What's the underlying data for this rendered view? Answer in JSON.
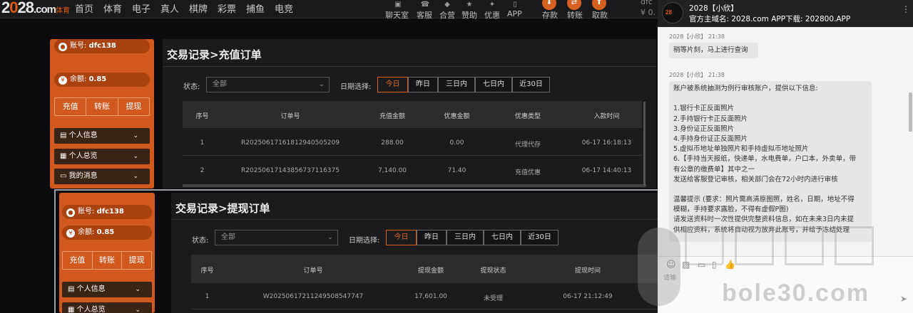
{
  "logo": {
    "text_a": "2",
    "text_b": "0",
    "text_c": "28",
    "text_d": ".com",
    "sub": "体育"
  },
  "nav": [
    "首页",
    "体育",
    "电子",
    "真人",
    "棋牌",
    "彩票",
    "捕鱼",
    "电竞"
  ],
  "right_nav": [
    "聊天室",
    "客服",
    "合营",
    "赞助",
    "优惠",
    "APP"
  ],
  "right_circles": [
    "存款",
    "转账",
    "取款"
  ],
  "user_mini": {
    "name": "dfc",
    "amount": "¥ 0."
  },
  "sidebar": {
    "account_label": "账号:",
    "account": "dfc138",
    "balance_label": "余额:",
    "balance": "0.85",
    "buttons": [
      "充值",
      "转账",
      "提现"
    ],
    "menu": [
      "个人信息",
      "个人总览",
      "我的消息"
    ]
  },
  "deposit_panel": {
    "title": "交易记录>充值订单",
    "status_label": "状态:",
    "status_value": "全部",
    "date_label": "日期选择:",
    "dates": [
      "今日",
      "昨日",
      "三日内",
      "七日内",
      "近30日"
    ],
    "columns": [
      "序号",
      "订单号",
      "充值金额",
      "优惠金额",
      "优惠类型",
      "入款时间"
    ],
    "rows": [
      [
        "1",
        "R20250617161812940505209",
        "288.00",
        "0.00",
        "代理代存",
        "06-17 16:18:13"
      ],
      [
        "2",
        "R20250617143856737116375",
        "7,140.00",
        "71.40",
        "充值优惠",
        "06-17 14:40:13"
      ]
    ]
  },
  "withdraw_panel": {
    "title": "交易记录>提现订单",
    "status_label": "状态:",
    "status_value": "全部",
    "date_label": "日期选择:",
    "dates": [
      "今日",
      "昨日",
      "三日内",
      "七日内",
      "近30日"
    ],
    "columns": [
      "序号",
      "订单号",
      "提现金额",
      "提现状态",
      "提现时间"
    ],
    "rows": [
      [
        "1",
        "W20250617211249508547747",
        "17,601.00",
        "未受理",
        "06-17 21:12:49"
      ]
    ]
  },
  "chat": {
    "header_title": "2028【小欣】",
    "header_sub": "官方主域名: 2028.com APP下载: 202800.APP",
    "msg1_meta": "2028【小欣】 21:38",
    "msg1": "稍等片刻，马上进行查询",
    "msg2_meta": "2028【小欣】 21:38",
    "msg2_lines": [
      "账户被系统抽测为例行审核账户，提供以下信息:",
      "",
      "1.银行卡正反面照片",
      "2.手持银行卡正反面照片",
      "3.身份证正反面照片",
      "4.手持身份证正反面照片",
      "5.虚拟币地址单独照片和手持虚拟币地址照片",
      "6.【手持当天报纸，快递单，水电费单，户口本，外卖单，带",
      "有公章的缴费单】其中之一",
      "发送给客服登记审核，相关部门会在72小时内进行审核",
      "",
      "温馨提示 (要求：照片需高清原图照，姓名，日期，地址不得",
      "模糊，手持要求露脸，不得有虚假P图)",
      "请发送资料时一次性提供完整资料信息，如在未来3日内未提",
      "供相应资料，系统将自动视为放弃此账号，并给予冻结处理"
    ],
    "input_hint": "请输",
    "watermark": "bole30.com"
  },
  "colors": {
    "accent": "#d56220",
    "panel": "#d1581e"
  }
}
